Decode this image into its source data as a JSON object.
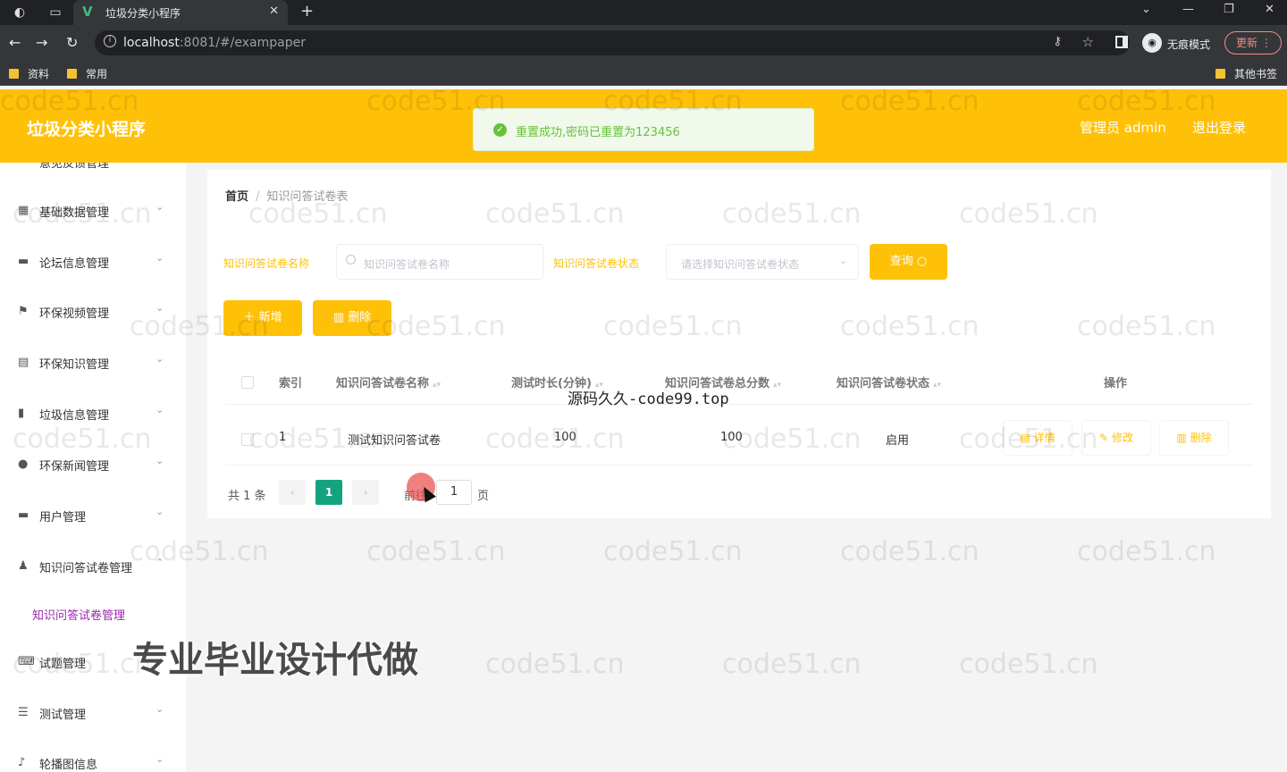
{
  "browser": {
    "tab_title": "垃圾分类小程序",
    "url_host": "localhost",
    "url_rest": ":8081/#/exampaper",
    "incognito_label": "无痕模式",
    "update_label": "更新",
    "bookmarks": [
      "资料",
      "常用"
    ],
    "other_bookmarks": "其他书签"
  },
  "header": {
    "title": "垃圾分类小程序",
    "admin": "管理员 admin",
    "logout": "退出登录"
  },
  "toast": {
    "message": "重置成功,密码已重置为123456"
  },
  "sidebar": {
    "items": [
      {
        "label": "基础数据管理",
        "icon": "grid-icon"
      },
      {
        "label": "论坛信息管理",
        "icon": "monitor-icon"
      },
      {
        "label": "环保视频管理",
        "icon": "flag-icon"
      },
      {
        "label": "环保知识管理",
        "icon": "document-icon"
      },
      {
        "label": "垃圾信息管理",
        "icon": "bar-chart-icon"
      },
      {
        "label": "环保新闻管理",
        "icon": "location-icon"
      },
      {
        "label": "用户管理",
        "icon": "chat-icon"
      },
      {
        "label": "知识问答试卷管理",
        "icon": "user-icon"
      },
      {
        "label": "试题管理",
        "icon": "keyboard-icon"
      },
      {
        "label": "测试管理",
        "icon": "list-icon"
      },
      {
        "label": "轮播图信息",
        "icon": "microphone-icon"
      }
    ],
    "active_sub": "知识问答试卷管理"
  },
  "breadcrumb": {
    "home": "首页",
    "current": "知识问答试卷表"
  },
  "filters": {
    "name_label": "知识问答试卷名称",
    "name_placeholder": "知识问答试卷名称",
    "status_label": "知识问答试卷状态",
    "status_placeholder": "请选择知识问答试卷状态",
    "query_button": "查询"
  },
  "actions": {
    "add": "新增",
    "delete": "删除"
  },
  "table": {
    "headers": {
      "index": "索引",
      "name": "知识问答试卷名称",
      "duration": "测试时长(分钟)",
      "total": "知识问答试卷总分数",
      "status": "知识问答试卷状态",
      "ops": "操作"
    },
    "rows": [
      {
        "index": "1",
        "name": "测试知识问答试卷",
        "duration": "100",
        "total": "100",
        "status": "启用"
      }
    ],
    "ops": {
      "detail": "详情",
      "edit": "修改",
      "delete": "删除"
    }
  },
  "pagination": {
    "total": "共 1 条",
    "current_page": "1",
    "goto_prefix": "前往",
    "goto_value": "1",
    "goto_suffix": "页"
  },
  "overlays": {
    "source": "源码久久-code99.top",
    "ad": "专业毕业设计代做",
    "watermark": "code51.cn"
  },
  "colors": {
    "brand": "#ffc107",
    "active_page": "#14a37f",
    "success": "#67c23a",
    "submenu_active": "#9c27b0"
  }
}
